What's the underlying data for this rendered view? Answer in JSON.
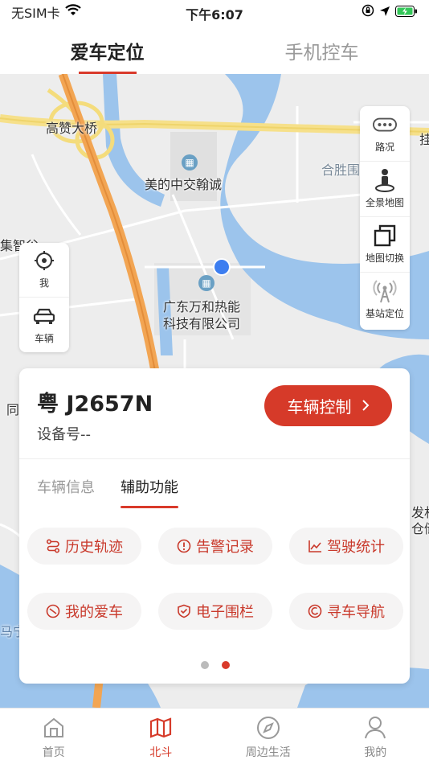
{
  "status_bar": {
    "carrier": "无SIM卡",
    "time": "下午6:07"
  },
  "top_tabs": [
    {
      "label": "爱车定位",
      "active": true
    },
    {
      "label": "手机控车",
      "active": false
    }
  ],
  "map": {
    "labels": {
      "bridge": "高赞大桥",
      "poi1": "美的中交翰诚",
      "poi2": "广东万和热能",
      "poi2b": "科技有限公司",
      "area1": "合胜围",
      "area2": "集智谷",
      "edge_right": "挂",
      "edge_left": "同",
      "edge_right2a": "发村",
      "edge_right2b": "仓储",
      "edge_road": "马宁"
    },
    "right_controls": [
      {
        "label": "路况",
        "icon": "traffic-icon"
      },
      {
        "label": "全景地图",
        "icon": "panorama-icon"
      },
      {
        "label": "地图切换",
        "icon": "layers-icon"
      },
      {
        "label": "基站定位",
        "icon": "antenna-icon"
      }
    ],
    "left_controls": [
      {
        "label": "我",
        "icon": "locate-icon"
      },
      {
        "label": "车辆",
        "icon": "car-icon"
      }
    ]
  },
  "vehicle_card": {
    "plate": "粤 J2657N",
    "device": "设备号--",
    "control_button": "车辆控制",
    "sub_tabs": [
      {
        "label": "车辆信息",
        "active": false
      },
      {
        "label": "辅助功能",
        "active": true
      }
    ],
    "features": [
      {
        "label": "历史轨迹",
        "icon": "route-icon"
      },
      {
        "label": "告警记录",
        "icon": "alert-icon"
      },
      {
        "label": "驾驶统计",
        "icon": "stats-icon"
      },
      {
        "label": "我的爱车",
        "icon": "car-badge-icon"
      },
      {
        "label": "电子围栏",
        "icon": "fence-icon"
      },
      {
        "label": "寻车导航",
        "icon": "navigate-icon"
      }
    ],
    "page": 2,
    "pages": 2
  },
  "bottom_nav": [
    {
      "label": "首页",
      "icon": "home-icon",
      "active": false
    },
    {
      "label": "北斗",
      "icon": "map-icon",
      "active": true
    },
    {
      "label": "周边生活",
      "icon": "compass-icon",
      "active": false
    },
    {
      "label": "我的",
      "icon": "user-icon",
      "active": false
    }
  ],
  "colors": {
    "accent": "#d63a29",
    "water": "#9cc4ec",
    "highway": "#f2a553"
  }
}
